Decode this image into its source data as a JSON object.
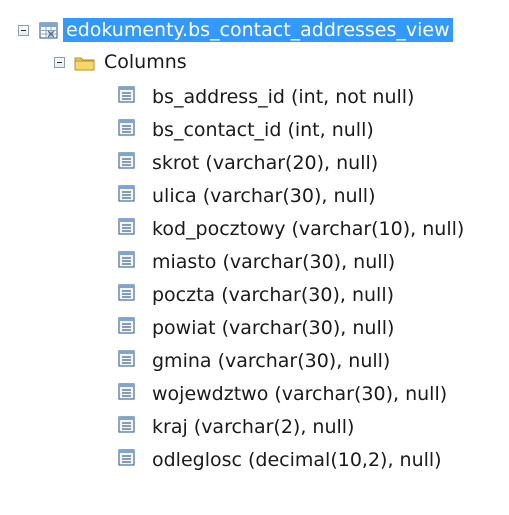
{
  "tree": {
    "view": {
      "label": "edokumenty.bs_contact_addresses_view",
      "icon": "view-icon",
      "selected": true,
      "expanded": true
    },
    "folder": {
      "label": "Columns",
      "icon": "folder-icon",
      "expanded": true
    },
    "columns": [
      {
        "label": "bs_address_id (int, not null)",
        "icon": "column-icon"
      },
      {
        "label": "bs_contact_id (int, null)",
        "icon": "column-icon"
      },
      {
        "label": "skrot (varchar(20), null)",
        "icon": "column-icon"
      },
      {
        "label": "ulica (varchar(30), null)",
        "icon": "column-icon"
      },
      {
        "label": "kod_pocztowy (varchar(10), null)",
        "icon": "column-icon"
      },
      {
        "label": "miasto (varchar(30), null)",
        "icon": "column-icon"
      },
      {
        "label": "poczta (varchar(30), null)",
        "icon": "column-icon"
      },
      {
        "label": "powiat (varchar(30), null)",
        "icon": "column-icon"
      },
      {
        "label": "gmina (varchar(30), null)",
        "icon": "column-icon"
      },
      {
        "label": "wojewdztwo (varchar(30), null)",
        "icon": "column-icon"
      },
      {
        "label": "kraj (varchar(2), null)",
        "icon": "column-icon"
      },
      {
        "label": "odleglosc (decimal(10,2), null)",
        "icon": "column-icon"
      }
    ],
    "colors": {
      "selection": "#3399ff",
      "folder": "#f3c74a",
      "icon_border": "#4a6f9a"
    }
  }
}
